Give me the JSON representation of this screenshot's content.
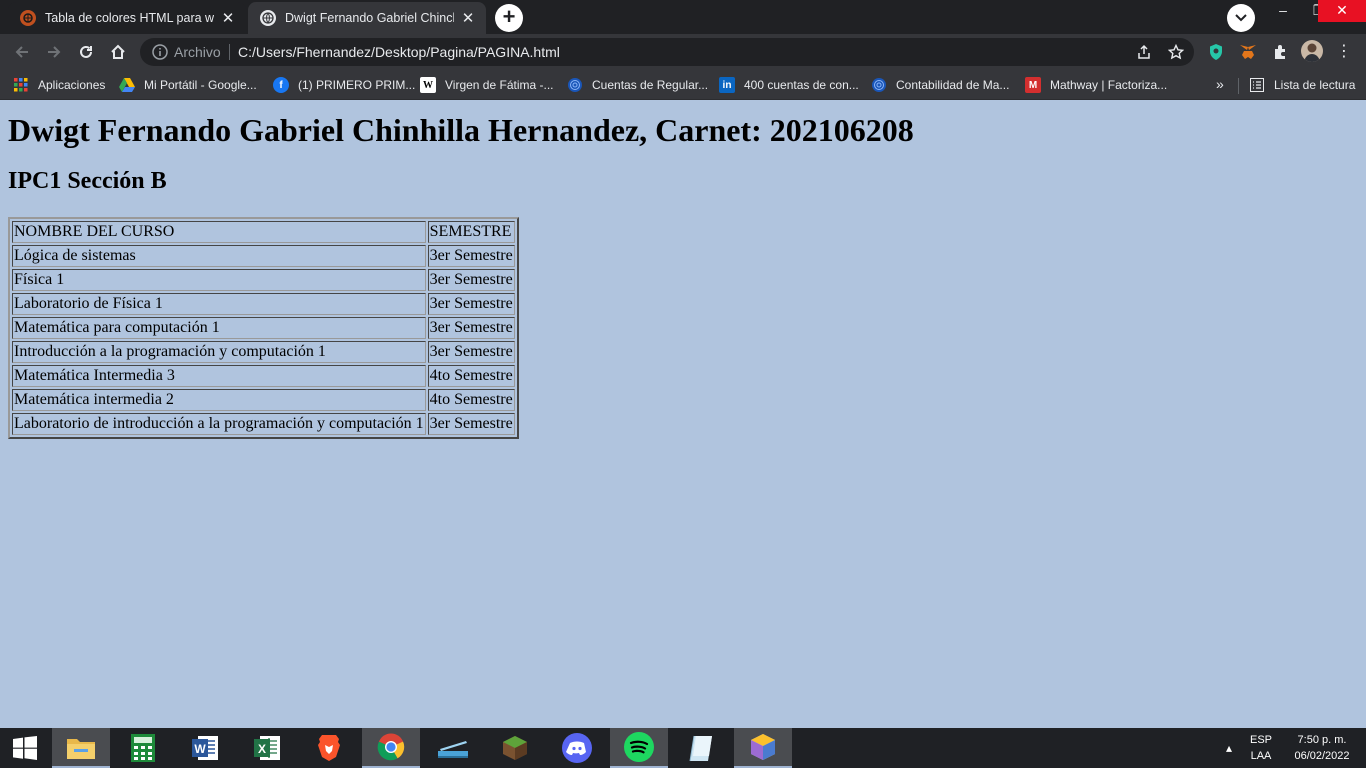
{
  "browser": {
    "tabs": [
      {
        "title": "Tabla de colores HTML para web",
        "icon": "web-tab-favicon-icon",
        "active": false
      },
      {
        "title": "Dwigt Fernando Gabriel Chinchilla",
        "icon": "globe-icon",
        "active": true
      }
    ],
    "address": {
      "prefix": "Archivo",
      "url": "C:/Users/Fhernandez/Desktop/Pagina/PAGINA.html"
    },
    "bookmarks": [
      {
        "label": "Aplicaciones",
        "icon": "apps-grid-icon"
      },
      {
        "label": "Mi Portátil - Google...",
        "icon": "google-drive-icon"
      },
      {
        "label": "(1) PRIMERO PRIM...",
        "icon": "facebook-icon"
      },
      {
        "label": "Virgen de Fátima -...",
        "icon": "wikipedia-icon"
      },
      {
        "label": "Cuentas de Regular...",
        "icon": "globe-icon"
      },
      {
        "label": "400 cuentas de con...",
        "icon": "linkedin-icon"
      },
      {
        "label": "Contabilidad de Ma...",
        "icon": "globe-icon"
      },
      {
        "label": "Mathway | Factoriza...",
        "icon": "mathway-icon"
      }
    ],
    "reading_list": "Lista de lectura",
    "more_bookmarks": "»"
  },
  "page": {
    "heading": "Dwigt Fernando Gabriel Chinhilla Hernandez, Carnet: 202106208",
    "subheading": "IPC1 Sección B",
    "table": {
      "headers": [
        "NOMBRE DEL CURSO",
        "SEMESTRE"
      ],
      "rows": [
        [
          "Lógica de sistemas",
          "3er Semestre"
        ],
        [
          "Física 1",
          "3er Semestre"
        ],
        [
          "Laboratorio de Física 1",
          "3er Semestre"
        ],
        [
          "Matemática para computación 1",
          "3er Semestre"
        ],
        [
          "Introducción a la programación y computación 1",
          "3er Semestre"
        ],
        [
          "Matemática Intermedia 3",
          "4to Semestre"
        ],
        [
          "Matemática intermedia 2",
          "4to Semestre"
        ],
        [
          "Laboratorio de introducción a la programación y computación 1",
          "3er Semestre"
        ]
      ]
    }
  },
  "taskbar": {
    "apps": [
      "windows-start-icon",
      "file-explorer-icon",
      "calculator-icon",
      "word-icon",
      "excel-icon",
      "brave-icon",
      "chrome-icon",
      "scanner-icon",
      "minecraft-icon",
      "discord-icon",
      "spotify-icon",
      "notes-icon",
      "virtualbox-icon"
    ],
    "language_top": "ESP",
    "language_bottom": "LAA",
    "time": "7:50 p. m.",
    "date": "06/02/2022"
  },
  "colors": {
    "page_background": "#b0c4de",
    "chrome_dark": "#202124",
    "chrome_toolbar": "#35363a",
    "close_button": "#e81123"
  }
}
